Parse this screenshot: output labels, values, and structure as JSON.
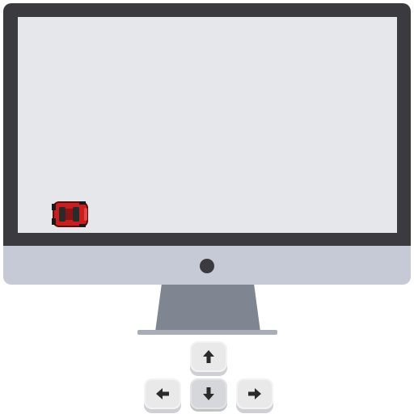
{
  "game": {
    "player": {
      "sprite": "red-car-topdown",
      "heading": "right"
    }
  },
  "controls": {
    "keys": [
      {
        "name": "up",
        "icon": "arrow-up-icon",
        "pressed": false
      },
      {
        "name": "left",
        "icon": "arrow-left-icon",
        "pressed": false
      },
      {
        "name": "down",
        "icon": "arrow-down-icon",
        "pressed": true
      },
      {
        "name": "right",
        "icon": "arrow-right-icon",
        "pressed": false
      }
    ]
  },
  "colors": {
    "bezel": "#3b3a3e",
    "screen": "#e6e7ea",
    "chin": "#c5cad6",
    "stand": "#7f8591",
    "car_body": "#c81e1e",
    "key_face": "#e9e9ea",
    "arrow": "#2b2b2b"
  }
}
